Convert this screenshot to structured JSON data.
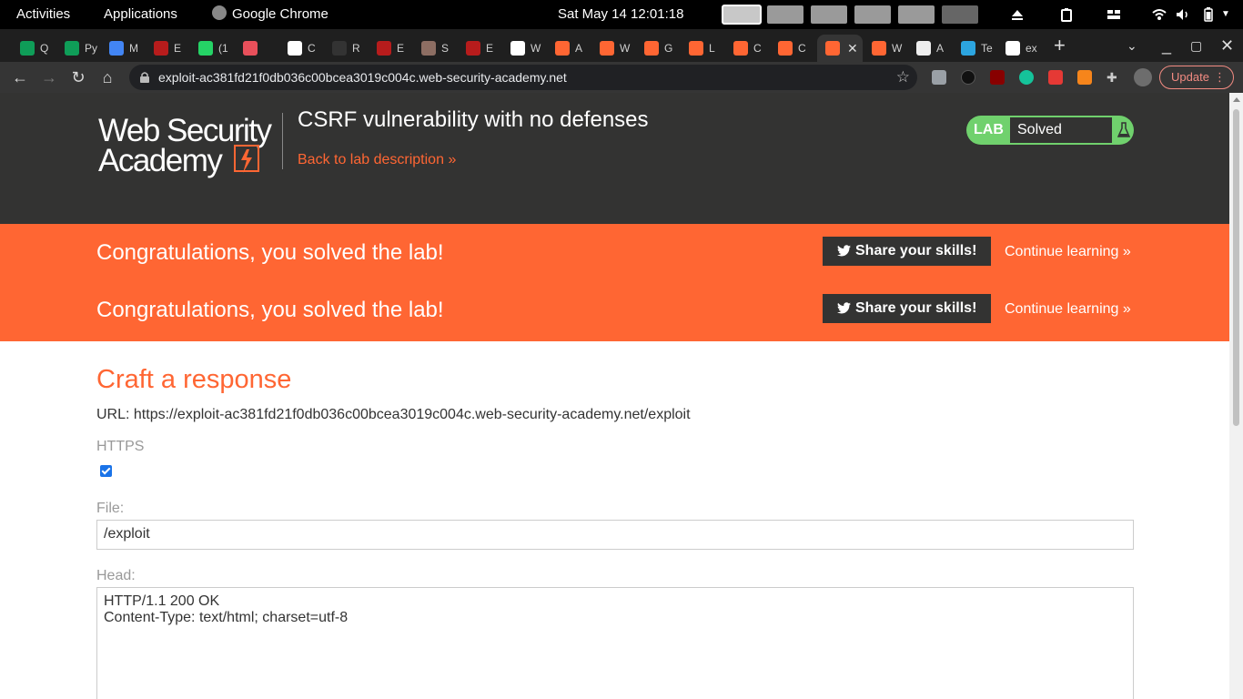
{
  "system": {
    "activities": "Activities",
    "applications": "Applications",
    "app_name": "Google Chrome",
    "clock": "Sat May 14  12:01:18"
  },
  "browser": {
    "tabs": [
      {
        "label": "Q",
        "color": "#0f9d58"
      },
      {
        "label": "Py",
        "color": "#0f9d58"
      },
      {
        "label": "M",
        "color": "#4285f4"
      },
      {
        "label": "E",
        "color": "#b71c1c"
      },
      {
        "label": "(1",
        "color": "#25d366"
      },
      {
        "label": "",
        "color": "#e8505b"
      },
      {
        "label": "C",
        "color": "#ffffff"
      },
      {
        "label": "R",
        "color": "#333333"
      },
      {
        "label": "E",
        "color": "#b71c1c"
      },
      {
        "label": "S",
        "color": "#8d6e63"
      },
      {
        "label": "E",
        "color": "#b71c1c"
      },
      {
        "label": "W",
        "color": "#ffffff"
      },
      {
        "label": "A",
        "color": "#ff6633"
      },
      {
        "label": "W",
        "color": "#ff6633"
      },
      {
        "label": "G",
        "color": "#ff6633"
      },
      {
        "label": "L",
        "color": "#ff6633"
      },
      {
        "label": "C",
        "color": "#ff6633"
      },
      {
        "label": "C",
        "color": "#ff6633"
      },
      {
        "label": "",
        "color": "#ff6633",
        "active": true
      },
      {
        "label": "W",
        "color": "#ff6633"
      },
      {
        "label": "A",
        "color": "#eeeeee"
      },
      {
        "label": "Te",
        "color": "#2ca5e0"
      },
      {
        "label": "ex",
        "color": "#ffffff"
      }
    ],
    "url": "exploit-ac381fd21f0db036c00bcea3019c004c.web-security-academy.net",
    "update_label": "Update"
  },
  "lab": {
    "logo_line1": "Web Security",
    "logo_line2": "Academy",
    "title": "CSRF vulnerability with no defenses",
    "back_link": "Back to lab description",
    "badge_lab": "LAB",
    "badge_status": "Solved",
    "accent_color": "#ff6633"
  },
  "banners": [
    {
      "text": "Congratulations, you solved the lab!",
      "share": "Share your skills!",
      "continue": "Continue learning"
    },
    {
      "text": "Congratulations, you solved the lab!",
      "share": "Share your skills!",
      "continue": "Continue learning"
    }
  ],
  "form": {
    "heading": "Craft a response",
    "url_line": "URL: https://exploit-ac381fd21f0db036c00bcea3019c004c.web-security-academy.net/exploit",
    "https_label": "HTTPS",
    "https_checked": true,
    "file_label": "File:",
    "file_value": "/exploit",
    "head_label": "Head:",
    "head_value": "HTTP/1.1 200 OK\nContent-Type: text/html; charset=utf-8"
  }
}
